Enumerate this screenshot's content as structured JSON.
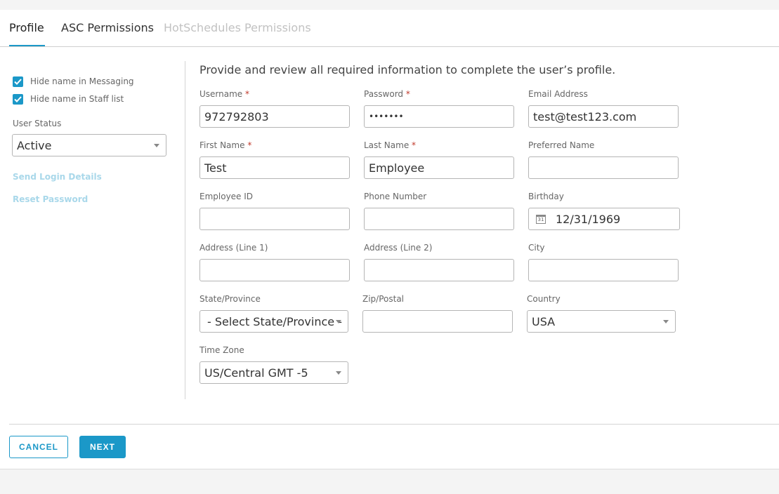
{
  "tabs": [
    {
      "label": "Profile"
    },
    {
      "label": "ASC Permissions"
    },
    {
      "label": "HotSchedules Permissions"
    }
  ],
  "left": {
    "hide_messaging": "Hide name in Messaging",
    "hide_staff": "Hide name in Staff list",
    "user_status_label": "User Status",
    "user_status_value": "Active",
    "send_login": "Send Login Details",
    "reset_password": "Reset Password"
  },
  "intro": "Provide and review all required information to complete the user’s profile.",
  "fields": {
    "username": {
      "label": "Username",
      "value": "972792803"
    },
    "password": {
      "label": "Password",
      "value": "•••••••"
    },
    "email": {
      "label": "Email Address",
      "value": "test@test123.com"
    },
    "first_name": {
      "label": "First Name",
      "value": "Test"
    },
    "last_name": {
      "label": "Last Name",
      "value": "Employee"
    },
    "preferred_name": {
      "label": "Preferred Name",
      "value": ""
    },
    "employee_id": {
      "label": "Employee ID",
      "value": ""
    },
    "phone": {
      "label": "Phone Number",
      "value": ""
    },
    "birthday": {
      "label": "Birthday",
      "value": "12/31/1969",
      "icon_text": "31"
    },
    "address1": {
      "label": "Address (Line 1)",
      "value": ""
    },
    "address2": {
      "label": "Address (Line 2)",
      "value": ""
    },
    "city": {
      "label": "City",
      "value": ""
    },
    "state": {
      "label": "State/Province",
      "value": "- Select State/Province -"
    },
    "zip": {
      "label": "Zip/Postal",
      "value": ""
    },
    "country": {
      "label": "Country",
      "value": "USA"
    },
    "timezone": {
      "label": "Time Zone",
      "value": "US/Central GMT -5"
    }
  },
  "required_mark": "*",
  "buttons": {
    "cancel": "CANCEL",
    "next": "NEXT"
  },
  "colors": {
    "accent": "#1b98c8",
    "required": "#c0392b",
    "link_disabled": "#a9d8ea"
  }
}
